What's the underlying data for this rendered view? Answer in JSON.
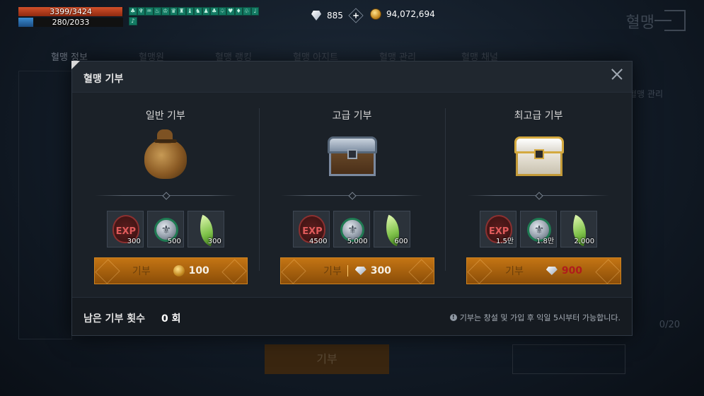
{
  "hud": {
    "hp": "3399/3424",
    "mp": "280/2033",
    "buffs": [
      "♣",
      "♆",
      "♒",
      "♨",
      "♔",
      "♛",
      "♜",
      "♝",
      "♞",
      "♟",
      "♣",
      "♤",
      "♥",
      "♦",
      "♧",
      "♩",
      "♪"
    ],
    "diamonds": "885",
    "gold": "94,072,694"
  },
  "background": {
    "title": "혈맹",
    "tabs": [
      "혈맹 정보",
      "혈맹원",
      "혈맹 랭킹",
      "혈맹 아지트",
      "혈맹 관리",
      "혈맹 채널"
    ],
    "side_link": "혈맹 관리",
    "count": "0/20",
    "donate_button": "기부"
  },
  "modal": {
    "title": "혈맹 기부",
    "tiers": [
      {
        "title": "일반 기부",
        "art": "sack",
        "rewards": [
          {
            "icon": "exp-badge",
            "count": "300"
          },
          {
            "icon": "clan-coin",
            "count": "500"
          },
          {
            "icon": "green-feather",
            "count": "300"
          }
        ],
        "button_label": "기부",
        "cost_icon": "gold-coin",
        "cost": "100",
        "affordable": true
      },
      {
        "title": "고급 기부",
        "art": "silver-chest",
        "rewards": [
          {
            "icon": "exp-badge",
            "count": "4500"
          },
          {
            "icon": "clan-coin",
            "count": "5,000"
          },
          {
            "icon": "green-feather",
            "count": "600"
          }
        ],
        "button_label": "기부",
        "cost_icon": "diamond",
        "cost": "300",
        "affordable": true
      },
      {
        "title": "최고급 기부",
        "art": "white-gold-chest",
        "rewards": [
          {
            "icon": "exp-badge",
            "count": "1.5만"
          },
          {
            "icon": "clan-coin",
            "count": "1.8만"
          },
          {
            "icon": "green-feather",
            "count": "2,000"
          }
        ],
        "button_label": "기부",
        "cost_icon": "diamond",
        "cost": "900",
        "affordable": false
      }
    ],
    "reward_exp_text": "EXP",
    "remaining_label": "남은 기부 횟수",
    "remaining_value": "0 회",
    "notice": "기부는 창설 및 가입 후 익일 5시부터 가능합니다."
  },
  "colors": {
    "accent_orange": "#c47514",
    "insufficient_red": "#b01c1c",
    "buff_green": "#137a63"
  }
}
